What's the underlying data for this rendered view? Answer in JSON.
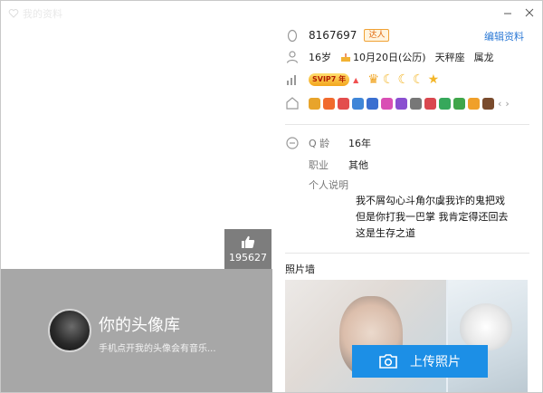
{
  "window": {
    "title": "我的资料"
  },
  "left": {
    "likes": "195627",
    "repo_title": "你的头像库",
    "repo_subtitle": "手机点开我的头像会有音乐..."
  },
  "profile": {
    "qq_number": "8167697",
    "tag_badge": "达人",
    "edit_link": "编辑资料",
    "age": "16岁",
    "birthday": "10月20日(公历)",
    "zodiac": "天秤座",
    "chinese_zodiac": "属龙",
    "vip_badge": "SVIP7 年",
    "q_age_label": "Q 龄",
    "q_age_value": "16年",
    "job_label": "职业",
    "job_value": "其他",
    "bio_label": "个人说明",
    "signature": [
      "我不屑勾心斗角尔虞我诈的鬼把戏",
      "但是你打我一巴掌 我肯定得还回去",
      "这是生存之道"
    ]
  },
  "photo_wall": {
    "title": "照片墙",
    "upload_label": "上传照片"
  },
  "colors": {
    "accent": "#1c8fe6",
    "link": "#2d7ad6",
    "left_gray": "#a7a7a7"
  },
  "icons": [
    "heart-icon",
    "penguin-icon",
    "person-icon",
    "level-chart-icon",
    "house-icon",
    "clock-icon",
    "thumb-up-icon",
    "camera-icon",
    "close-icon",
    "minimize-icon"
  ]
}
